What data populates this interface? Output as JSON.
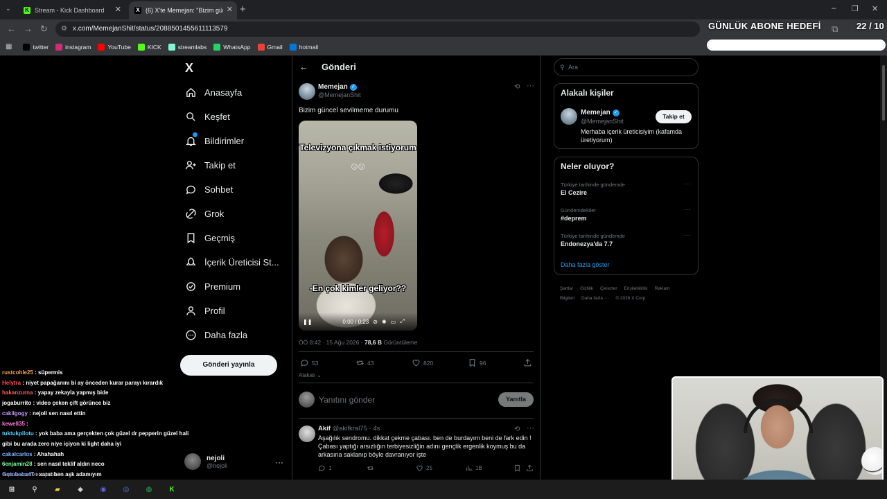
{
  "browser": {
    "tabs": [
      {
        "title": "Stream - Kick Dashboard",
        "favicon": "kick-icon"
      },
      {
        "title": "(6) X'te Memejan: \"Bizim günce",
        "favicon": "x-icon"
      }
    ],
    "url": "x.com/MemejanShit/status/2088501455611113579",
    "bookmarks": [
      {
        "label": "twitter",
        "icon": "x-icon",
        "color": "#000000"
      },
      {
        "label": "instagram",
        "icon": "instagram-icon",
        "color": "#d62976"
      },
      {
        "label": "YouTube",
        "icon": "youtube-icon",
        "color": "#ff0000"
      },
      {
        "label": "KICK",
        "icon": "kick-icon",
        "color": "#53fc18"
      },
      {
        "label": "streamlabs",
        "icon": "streamlabs-icon",
        "color": "#80f5d2"
      },
      {
        "label": "WhatsApp",
        "icon": "whatsapp-icon",
        "color": "#25d366"
      },
      {
        "label": "Gmail",
        "icon": "gmail-icon",
        "color": "#ea4335"
      },
      {
        "label": "hotmail",
        "icon": "outlook-icon",
        "color": "#0078d4"
      }
    ]
  },
  "overlay": {
    "goal_title": "GÜNLÜK ABONE HEDEFİ",
    "goal_count": "22 / 10",
    "goal_progress": 1.0
  },
  "nav": {
    "logo": "X",
    "items": [
      {
        "label": "Anasayfa",
        "icon": "home-icon"
      },
      {
        "label": "Keşfet",
        "icon": "search-icon"
      },
      {
        "label": "Bildirimler",
        "icon": "bell-icon"
      },
      {
        "label": "Takip et",
        "icon": "follow-icon"
      },
      {
        "label": "Sohbet",
        "icon": "chat-icon"
      },
      {
        "label": "Grok",
        "icon": "grok-icon"
      },
      {
        "label": "Geçmiş",
        "icon": "bookmark-icon"
      },
      {
        "label": "İçerik Üreticisi St...",
        "icon": "rocket-icon"
      },
      {
        "label": "Premium",
        "icon": "premium-icon"
      },
      {
        "label": "Profil",
        "icon": "profile-icon"
      },
      {
        "label": "Daha fazla",
        "icon": "more-icon"
      }
    ],
    "post_button": "Gönderi yayınla",
    "account": {
      "name": "nejoli",
      "handle": "@nejoli"
    }
  },
  "main": {
    "title": "Gönderi",
    "post": {
      "author": "Memejan",
      "handle": "@MemejanShit",
      "text": "Bizim güncel sevilmeme durumu",
      "video": {
        "caption_top": "Televizyona çıkmak istiyorum",
        "emoji": "😕😕",
        "caption_bottom": "-En çok kimler geliyor??",
        "time": "0:00 / 0:23"
      },
      "meta_time": "ÖÖ 8:42 · 15 Ağu 2026 · ",
      "meta_views": "78,6 B",
      "meta_views_label": " Görüntüleme",
      "stats": {
        "replies": "53",
        "reposts": "43",
        "likes": "820",
        "bookmarks": "96"
      },
      "relevant": "Alakalı"
    },
    "reply_placeholder": "Yanıtını gönder",
    "reply_button": "Yanıtla",
    "comment": {
      "name": "Akif",
      "handle": "@akifkral75 · 4s",
      "text": "Aşağılık sendromu. dikkat çekme çabası. ben de burdayım beni de fark edin ! Çabası yaptığı arsızlığın terbiyesizliğin adını gençlik ergenlik koymuş bu da arkasına saklanıp böyle davranıyor işte",
      "stats": {
        "replies": "1",
        "reposts": "",
        "likes": "25",
        "views": "1B"
      }
    }
  },
  "sidebar": {
    "search_placeholder": "Ara",
    "relevant_title": "Alakalı kişiler",
    "person": {
      "name": "Memejan",
      "handle": "@MemejanShit",
      "follow": "Takip et",
      "bio": "Merhaba içerik üreticisiyim (kafamda üretiyorum)"
    },
    "trends_title": "Neler oluyor?",
    "trends": [
      {
        "context": "Türkiye tarihinde gündemde",
        "name": "El Cezire"
      },
      {
        "context": "Gündemdekiler",
        "name": "#deprem"
      },
      {
        "context": "Türkiye tarihinde gündemde",
        "name": "Endonezya'da 7.7"
      }
    ],
    "show_more": "Daha fazla göster",
    "footer": [
      "Şartlar",
      "Gizlilik",
      "Çerezler",
      "Erişilebilirlik",
      "Reklam Bilgileri",
      "Daha fazla ···",
      "© 2026 X Corp."
    ]
  },
  "chat": [
    {
      "user": "rustcohle25",
      "color": "#f6a04d",
      "msg": " : süpermis"
    },
    {
      "user": "Helytra",
      "color": "#ff4d4d",
      "msg": " : niyet papağanını bi ay önceden kurar parayı kırardık"
    },
    {
      "user": "hakanzurna",
      "color": "#ff5c5c",
      "msg": " : yapay zekayla yapmış bide"
    },
    {
      "user": "jogaburrito",
      "color": "#ffffff",
      "msg": " : video çeken çift görünce biz"
    },
    {
      "user": "cakilgogy",
      "color": "#c79bff",
      "msg": " : nejoli sen nasıl ettin"
    },
    {
      "user": "kewell35",
      "color": "#ff7ad9",
      "msg": " :"
    },
    {
      "user": "tuktukpilotu",
      "color": "#5ad1ff",
      "msg": " : yok baba ama gerçekten çok güzel dr pepperin güzel hali gibi bu arada zero niye içiyon ki light daha iyi"
    },
    {
      "user": "cakalcarlos",
      "color": "#7fb2ff",
      "msg": " : Ahahahah"
    },
    {
      "user": "6enjamin28",
      "color": "#7cfc9c",
      "msg": " : sen nasıl teklif aldın neco"
    },
    {
      "user": "Gotobaba47",
      "color": "#6f8cff",
      "msg": " : xarat ben aşk adamıyım"
    },
    {
      "user": "rustcohle25",
      "color": "#f6a04d",
      "msg": " :"
    }
  ],
  "status_url": "https://x.com/MemejanShit",
  "taskbar": [
    {
      "icon": "windows-icon",
      "color": "#ffffff"
    },
    {
      "icon": "search-icon",
      "color": "#ffffff"
    },
    {
      "icon": "file-explorer-icon",
      "color": "#f4c542"
    },
    {
      "icon": "app-icon",
      "color": "#cfcfcf"
    },
    {
      "icon": "discord-icon",
      "color": "#5865f2"
    },
    {
      "icon": "chrome-icon",
      "color": "#4285f4"
    },
    {
      "icon": "spotify-icon",
      "color": "#1db954"
    },
    {
      "icon": "kick-icon",
      "color": "#53fc18"
    }
  ]
}
